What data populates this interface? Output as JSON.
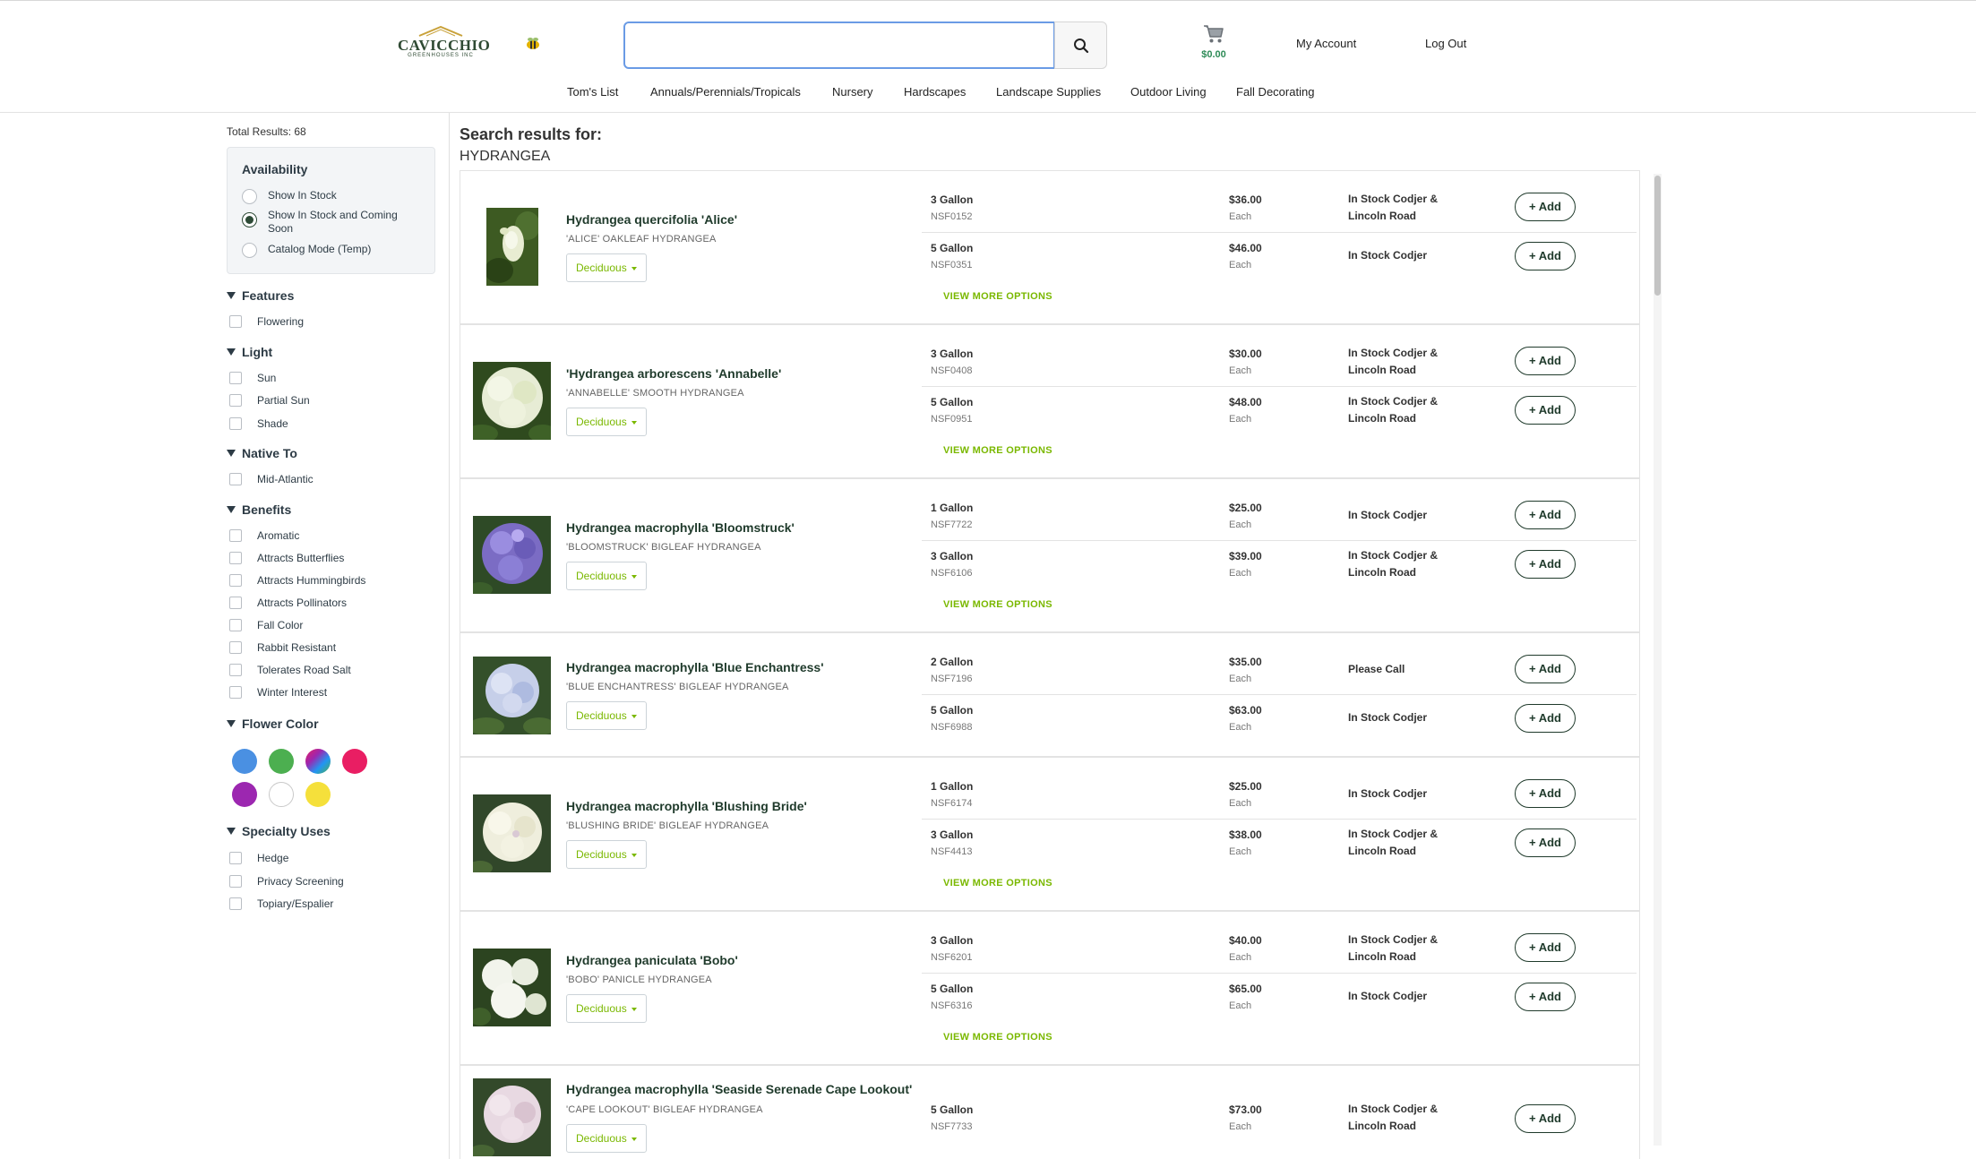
{
  "header": {
    "logo_text": "CAVICCHIO",
    "logo_sub": "GREENHOUSES INC",
    "search_placeholder": "",
    "cart_total": "$0.00",
    "my_account": "My Account",
    "log_out": "Log Out"
  },
  "nav": [
    "Tom's List",
    "Annuals/Perennials/Tropicals",
    "Nursery",
    "Hardscapes",
    "Landscape Supplies",
    "Outdoor Living",
    "Fall Decorating"
  ],
  "sidebar": {
    "total_results": "Total Results: 68",
    "availability": {
      "title": "Availability",
      "options": [
        "Show In Stock",
        "Show In Stock and Coming Soon",
        "Catalog Mode (Temp)"
      ],
      "selected_index": 1
    },
    "features": {
      "title": "Features",
      "items": [
        "Flowering"
      ]
    },
    "light": {
      "title": "Light",
      "items": [
        "Sun",
        "Partial Sun",
        "Shade"
      ]
    },
    "native_to": {
      "title": "Native To",
      "items": [
        "Mid-Atlantic"
      ]
    },
    "benefits": {
      "title": "Benefits",
      "items": [
        "Aromatic",
        "Attracts Butterflies",
        "Attracts Hummingbirds",
        "Attracts Pollinators",
        "Fall Color",
        "Rabbit Resistant",
        "Tolerates Road Salt",
        "Winter Interest"
      ]
    },
    "flower_color": {
      "title": "Flower Color",
      "swatches": [
        "#4a90e2",
        "#4caf50",
        "multicolor",
        "#e91e63",
        "#9c27b0",
        "#ffffff",
        "#f5e03b"
      ]
    },
    "specialty_uses": {
      "title": "Specialty Uses",
      "items": [
        "Hedge",
        "Privacy Screening",
        "Topiary/Espalier"
      ]
    }
  },
  "main": {
    "search_results_for": "Search results for:",
    "query": "HYDRANGEA",
    "view_more": "VIEW MORE OPTIONS",
    "add_label": "+ Add",
    "tag_label": "Deciduous",
    "each_label": "Each",
    "products": [
      {
        "name": "Hydrangea quercifolia 'Alice'",
        "common": "'ALICE' OAKLEAF HYDRANGEA",
        "options": [
          {
            "size": "3 Gallon",
            "sku": "NSF0152",
            "price": "$36.00",
            "stock": "In Stock Codjer & Lincoln Road"
          },
          {
            "size": "5 Gallon",
            "sku": "NSF0351",
            "price": "$46.00",
            "stock": "In Stock Codjer"
          }
        ]
      },
      {
        "name": "'Hydrangea arborescens 'Annabelle'",
        "common": "'ANNABELLE' SMOOTH HYDRANGEA",
        "options": [
          {
            "size": "3 Gallon",
            "sku": "NSF0408",
            "price": "$30.00",
            "stock": "In Stock Codjer & Lincoln Road"
          },
          {
            "size": "5 Gallon",
            "sku": "NSF0951",
            "price": "$48.00",
            "stock": "In Stock Codjer & Lincoln Road"
          }
        ]
      },
      {
        "name": "Hydrangea macrophylla 'Bloomstruck'",
        "common": "'BLOOMSTRUCK' BIGLEAF HYDRANGEA",
        "options": [
          {
            "size": "1 Gallon",
            "sku": "NSF7722",
            "price": "$25.00",
            "stock": "In Stock Codjer"
          },
          {
            "size": "3 Gallon",
            "sku": "NSF6106",
            "price": "$39.00",
            "stock": "In Stock Codjer & Lincoln Road"
          }
        ]
      },
      {
        "name": "Hydrangea macrophylla 'Blue Enchantress'",
        "common": "'BLUE ENCHANTRESS' BIGLEAF HYDRANGEA",
        "options": [
          {
            "size": "2 Gallon",
            "sku": "NSF7196",
            "price": "$35.00",
            "stock": "Please Call"
          },
          {
            "size": "5 Gallon",
            "sku": "NSF6988",
            "price": "$63.00",
            "stock": "In Stock Codjer"
          }
        ]
      },
      {
        "name": "Hydrangea macrophylla 'Blushing Bride'",
        "common": "'BLUSHING BRIDE' BIGLEAF HYDRANGEA",
        "options": [
          {
            "size": "1 Gallon",
            "sku": "NSF6174",
            "price": "$25.00",
            "stock": "In Stock Codjer"
          },
          {
            "size": "3 Gallon",
            "sku": "NSF4413",
            "price": "$38.00",
            "stock": "In Stock Codjer & Lincoln Road"
          }
        ]
      },
      {
        "name": "Hydrangea paniculata 'Bobo'",
        "common": "'BOBO' PANICLE HYDRANGEA",
        "options": [
          {
            "size": "3 Gallon",
            "sku": "NSF6201",
            "price": "$40.00",
            "stock": "In Stock Codjer & Lincoln Road"
          },
          {
            "size": "5 Gallon",
            "sku": "NSF6316",
            "price": "$65.00",
            "stock": "In Stock Codjer"
          }
        ]
      },
      {
        "name": "Hydrangea macrophylla 'Seaside Serenade Cape Lookout'",
        "common": "'CAPE LOOKOUT' BIGLEAF HYDRANGEA",
        "options": [
          {
            "size": "5 Gallon",
            "sku": "NSF7733",
            "price": "$73.00",
            "stock": "In Stock Codjer & Lincoln Road"
          }
        ]
      }
    ]
  }
}
